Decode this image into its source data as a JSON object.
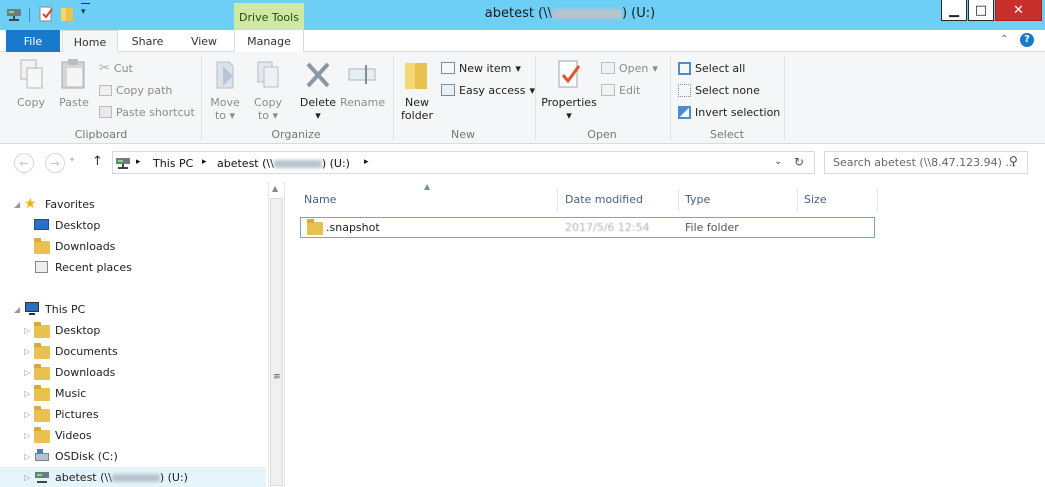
{
  "window": {
    "title_prefix": "abetest (\\\\",
    "title_suffix": ") (U:)",
    "contextual_tab": "Drive Tools",
    "controls": {
      "minimize": "▁",
      "maximize": "□",
      "close": "✕"
    }
  },
  "tabs": {
    "file": "File",
    "home": "Home",
    "share": "Share",
    "view": "View",
    "manage": "Manage"
  },
  "ribbon": {
    "clipboard": {
      "label": "Clipboard",
      "copy": "Copy",
      "paste": "Paste",
      "cut": "Cut",
      "copy_path": "Copy path",
      "paste_shortcut": "Paste shortcut"
    },
    "organize": {
      "label": "Organize",
      "move_to": "Move",
      "move_to_2": "to",
      "copy_to": "Copy",
      "copy_to_2": "to",
      "delete": "Delete",
      "rename": "Rename"
    },
    "new": {
      "label": "New",
      "new_folder": "New",
      "new_folder_2": "folder",
      "new_item": "New item",
      "easy_access": "Easy access"
    },
    "open": {
      "label": "Open",
      "properties": "Properties",
      "open": "Open",
      "edit": "Edit"
    },
    "select": {
      "label": "Select",
      "select_all": "Select all",
      "select_none": "Select none",
      "invert_selection": "Invert selection"
    }
  },
  "address": {
    "crumb_this_pc": "This PC",
    "crumb_drive_prefix": "abetest (\\\\",
    "crumb_drive_suffix": ") (U:)",
    "search_placeholder": "Search abetest (\\\\8.47.123.94) ..."
  },
  "navigation": {
    "favorites_label": "Favorites",
    "favorites": [
      "Desktop",
      "Downloads",
      "Recent places"
    ],
    "this_pc_label": "This PC",
    "this_pc_items": [
      "Desktop",
      "Documents",
      "Downloads",
      "Music",
      "Pictures",
      "Videos",
      "OSDisk (C:)"
    ],
    "selected_prefix": "abetest (\\\\",
    "selected_suffix": ") (U:)"
  },
  "columns": {
    "name": "Name",
    "date_modified": "Date modified",
    "type": "Type",
    "size": "Size"
  },
  "files": [
    {
      "name": ".snapshot",
      "date_modified": "2017/5/6 12:54",
      "type": "File folder",
      "size": ""
    }
  ],
  "colors": {
    "titlebar": "#6ecff6",
    "file_tab": "#1979ca",
    "drive_tools": "#cfe9a4",
    "close_button": "#c7302b",
    "selection": "#e5f3fb"
  }
}
